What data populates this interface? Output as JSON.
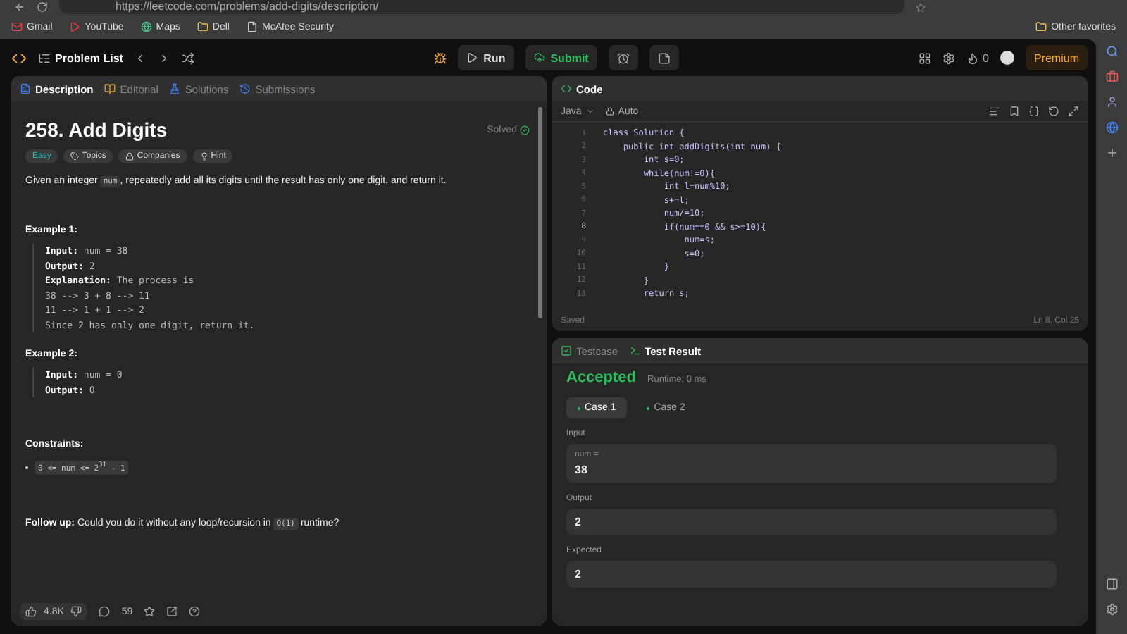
{
  "browser": {
    "url": "https://leetcode.com/problems/add-digits/description/",
    "bookmarks": [
      "Gmail",
      "YouTube",
      "Maps",
      "Dell",
      "McAfee Security"
    ],
    "other_favorites": "Other favorites"
  },
  "header": {
    "problem_list": "Problem List",
    "run": "Run",
    "submit": "Submit",
    "streak": "0",
    "premium": "Premium"
  },
  "left_tabs": [
    {
      "label": "Description",
      "selected": true
    },
    {
      "label": "Editorial",
      "selected": false
    },
    {
      "label": "Solutions",
      "selected": false
    },
    {
      "label": "Submissions",
      "selected": false
    }
  ],
  "problem": {
    "title": "258. Add Digits",
    "status": "Solved",
    "difficulty": "Easy",
    "tags": [
      "Topics",
      "Companies",
      "Hint"
    ],
    "description": [
      {
        "kind": "text",
        "text": "Given an integer "
      },
      {
        "kind": "code",
        "text": "num"
      },
      {
        "kind": "text",
        "text": ", repeatedly add all its digits until the result has only one digit, and return it."
      }
    ],
    "examples": [
      {
        "title": "Example 1:",
        "lines": [
          {
            "label": "Input:",
            "value": "num = 38"
          },
          {
            "label": "Output:",
            "value": "2"
          },
          {
            "label": "Explanation:",
            "value": "The process is"
          },
          {
            "value": "38 --> 3 + 8 --> 11"
          },
          {
            "value": "11 --> 1 + 1 --> 2"
          },
          {
            "value": "Since 2 has only one digit, return it."
          }
        ]
      },
      {
        "title": "Example 2:",
        "lines": [
          {
            "label": "Input:",
            "value": "num = 0"
          },
          {
            "label": "Output:",
            "value": "0"
          }
        ]
      }
    ],
    "constraints_title": "Constraints:",
    "constraints": [
      "0 <= num <= 2$^{31}$ - 1"
    ],
    "follow_up": [
      {
        "kind": "bold",
        "text": "Follow up:"
      },
      {
        "kind": "text",
        "text": " Could you do it without any loop/recursion in "
      },
      {
        "kind": "code",
        "text": "O(1)"
      },
      {
        "kind": "text",
        "text": " runtime?"
      }
    ]
  },
  "footer": {
    "likes": "4.8K",
    "comments": "59"
  },
  "code_panel": {
    "title": "Code",
    "language": "Java",
    "mode": "Auto",
    "status": "Saved",
    "cursor": "Ln 8, Col 25",
    "lines": [
      {
        "number": "1",
        "text": "class Solution {",
        "selected": false
      },
      {
        "number": "2",
        "text": "    public int addDigits(int num) {",
        "selected": false
      },
      {
        "number": "3",
        "text": "        int s=0;",
        "selected": false
      },
      {
        "number": "4",
        "text": "        while(num!=0){",
        "selected": false
      },
      {
        "number": "5",
        "text": "            int l=num%10;",
        "selected": false
      },
      {
        "number": "6",
        "text": "            s+=l;",
        "selected": false
      },
      {
        "number": "7",
        "text": "            num/=10;",
        "selected": false
      },
      {
        "number": "8",
        "text": "            if(num==0 && s>=10){",
        "selected": true
      },
      {
        "number": "9",
        "text": "                num=s;",
        "selected": false
      },
      {
        "number": "10",
        "text": "                s=0;",
        "selected": false
      },
      {
        "number": "11",
        "text": "            }",
        "selected": false
      },
      {
        "number": "12",
        "text": "        }",
        "selected": false
      },
      {
        "number": "13",
        "text": "        return s;",
        "selected": false
      }
    ]
  },
  "result_tabs": [
    {
      "label": "Testcase",
      "selected": false
    },
    {
      "label": "Test Result",
      "selected": true
    }
  ],
  "result": {
    "verdict": "Accepted",
    "runtime": "Runtime: 0 ms",
    "cases": [
      {
        "label": "Case 1",
        "selected": true
      },
      {
        "label": "Case 2",
        "selected": false
      }
    ],
    "input_label": "Input",
    "input_name": "num =",
    "input_value": "38",
    "output_label": "Output",
    "output_value": "2",
    "expected_label": "Expected",
    "expected_value": "2"
  }
}
